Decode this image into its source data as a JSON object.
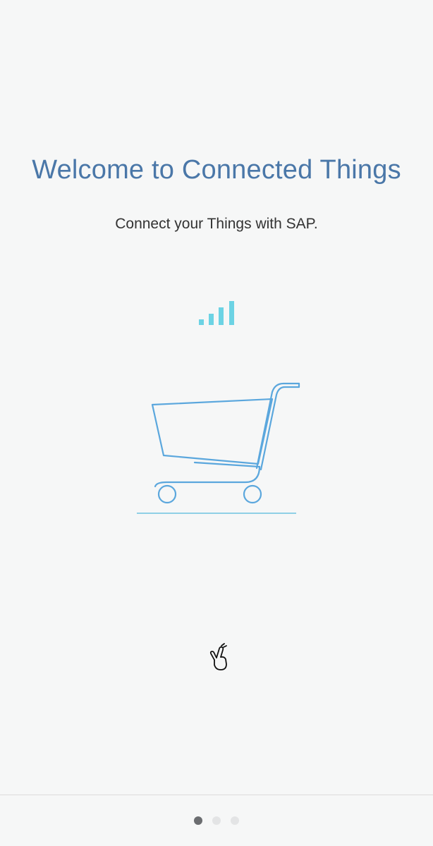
{
  "welcome": {
    "title": "Welcome to Connected Things",
    "subtitle": "Connect your Things with SAP."
  },
  "illustration": {
    "signal_icon": "signal-bars-icon",
    "cart_icon": "shopping-cart-icon",
    "gesture_icon": "swipe-hand-icon",
    "accent_color": "#6cc4e0",
    "cart_color": "#5ba7dd"
  },
  "pager": {
    "page_count": 3,
    "current_page": 1
  },
  "colors": {
    "background": "#f6f7f7",
    "title": "#4a77a8",
    "subtitle": "#333333",
    "dot_active": "#6b6d70",
    "dot_inactive": "#e3e4e5"
  }
}
